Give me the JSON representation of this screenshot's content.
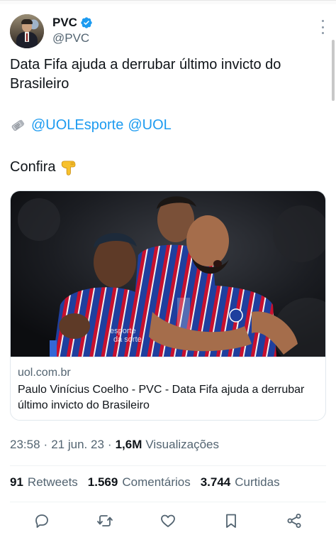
{
  "author": {
    "name": "PVC",
    "handle": "@PVC",
    "verified": true
  },
  "tweet": {
    "text": "Data Fifa ajuda a derrubar último invicto do Brasileiro",
    "mentions": [
      "@UOLEsporte",
      "@UOL"
    ],
    "confira": "Confira"
  },
  "card": {
    "domain": "uol.com.br",
    "title": "Paulo Vinícius Coelho - PVC - Data Fifa ajuda a derrubar último invicto do Brasileiro"
  },
  "meta": {
    "time": "23:58",
    "separator1": "·",
    "date": "21 jun. 23",
    "separator2": "·",
    "views_count": "1,6M",
    "views_label": "Visualizações"
  },
  "stats": {
    "retweets_count": "91",
    "retweets_label": "Retweets",
    "comments_count": "1.569",
    "comments_label": "Comentários",
    "likes_count": "3.744",
    "likes_label": "Curtidas"
  },
  "colors": {
    "link": "#1d9bf0",
    "verified": "#1d9bf0",
    "secondary_text": "#536471",
    "jersey_blue": "#1f3f9e",
    "jersey_red": "#c8102e"
  },
  "icons": {
    "verified": "verified-badge-icon",
    "more": "more-vertical-icon",
    "news": "newspaper-icon",
    "pointing": "pointing-down-emoji-icon",
    "reply": "reply-icon",
    "retweet": "retweet-icon",
    "like": "heart-icon",
    "bookmark": "bookmark-icon",
    "share": "share-icon"
  }
}
